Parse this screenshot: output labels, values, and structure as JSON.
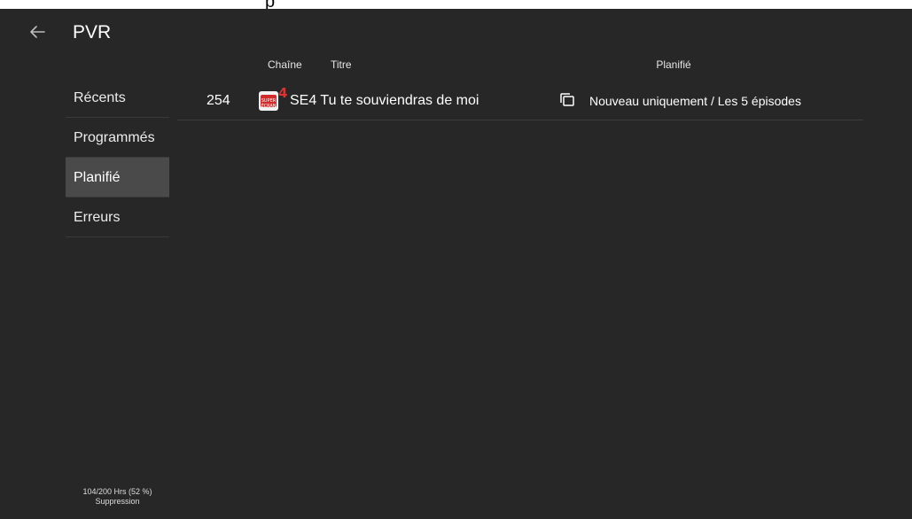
{
  "top_strip": {
    "glyph": "p"
  },
  "header": {
    "title": "PVR",
    "back_icon": "arrow-left-icon"
  },
  "sidebar": {
    "items": [
      {
        "label": "Récents",
        "active": false
      },
      {
        "label": "Programmés",
        "active": false
      },
      {
        "label": "Planifié",
        "active": true
      },
      {
        "label": "Erreurs",
        "active": false
      }
    ],
    "storage": {
      "usage": "104/200 Hrs (52 %)",
      "label": "Suppression"
    }
  },
  "table": {
    "columns": {
      "channel": "Chaîne",
      "title": "Titre",
      "planned": "Planifié"
    },
    "rows": [
      {
        "channel_number": "254",
        "channel_logo_text": "SUPER ÉCRAN",
        "channel_logo_badge": "4",
        "title": "SE4 Tu te souviendras de moi",
        "schedule_icon": "series-copy-icon",
        "schedule": "Nouveau uniquement / Les 5 épisodes"
      }
    ]
  },
  "colors": {
    "background": "#272727",
    "active_item": "#4a4a4a",
    "text": "#ffffff",
    "divider": "#3d3d3d",
    "logo_red": "#d12b2b"
  }
}
